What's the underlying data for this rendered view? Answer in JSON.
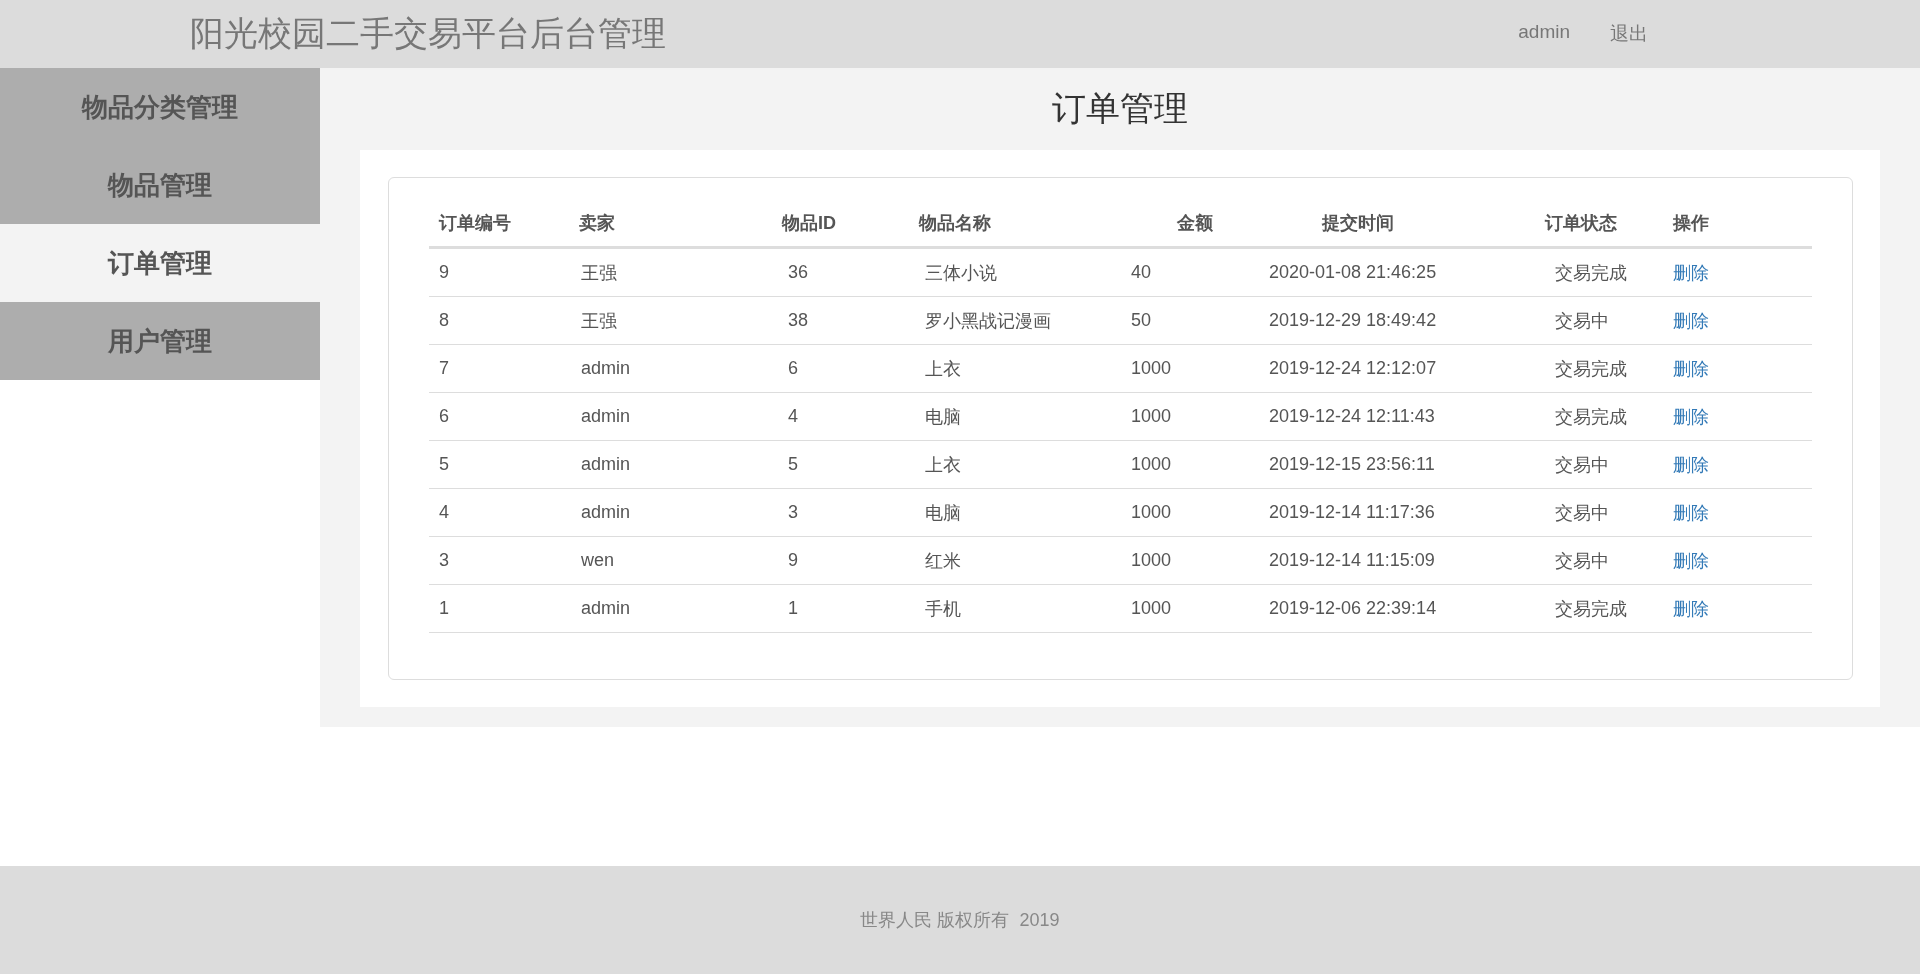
{
  "header": {
    "title": "阳光校园二手交易平台后台管理",
    "user": "admin",
    "logout": "退出"
  },
  "sidebar": {
    "items": [
      {
        "label": "物品分类管理",
        "selected": false
      },
      {
        "label": "物品管理",
        "selected": false
      },
      {
        "label": "订单管理",
        "selected": true
      },
      {
        "label": "用户管理",
        "selected": false
      }
    ]
  },
  "page_title": "订单管理",
  "table": {
    "columns": [
      "订单编号",
      "卖家",
      "物品ID",
      "物品名称",
      "金额",
      "提交时间",
      "订单状态",
      "操作"
    ],
    "rows": [
      [
        "9",
        "王强",
        "36",
        "三体小说",
        "40",
        "2020-01-08 21:46:25",
        "交易完成",
        "删除"
      ],
      [
        "8",
        "王强",
        "38",
        "罗小黑战记漫画",
        "50",
        "2019-12-29 18:49:42",
        "交易中",
        "删除"
      ],
      [
        "7",
        "admin",
        "6",
        "上衣",
        "1000",
        "2019-12-24 12:12:07",
        "交易完成",
        "删除"
      ],
      [
        "6",
        "admin",
        "4",
        "电脑",
        "1000",
        "2019-12-24 12:11:43",
        "交易完成",
        "删除"
      ],
      [
        "5",
        "admin",
        "5",
        "上衣",
        "1000",
        "2019-12-15 23:56:11",
        "交易中",
        "删除"
      ],
      [
        "4",
        "admin",
        "3",
        "电脑",
        "1000",
        "2019-12-14 11:17:36",
        "交易中",
        "删除"
      ],
      [
        "3",
        "wen",
        "9",
        "红米",
        "1000",
        "2019-12-14 11:15:09",
        "交易中",
        "删除"
      ],
      [
        "1",
        "admin",
        "1",
        "手机",
        "1000",
        "2019-12-06 22:39:14",
        "交易完成",
        "删除"
      ]
    ]
  },
  "footer": "世界人民 版权所有  2019"
}
